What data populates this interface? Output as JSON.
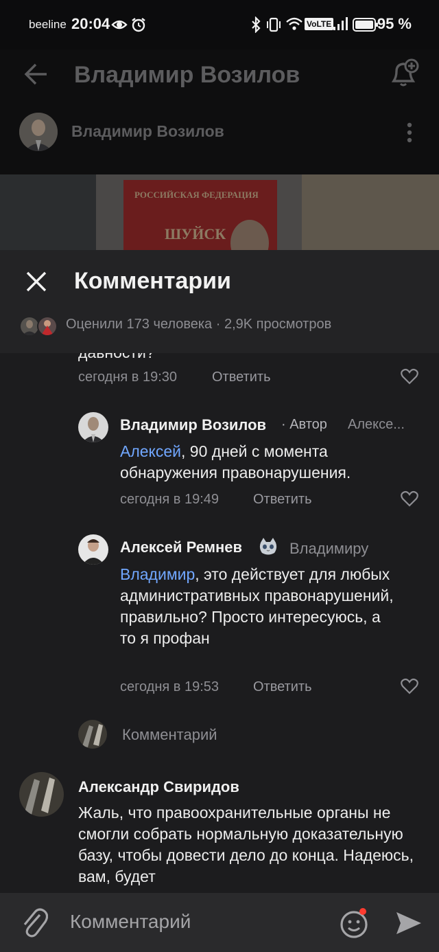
{
  "status_bar": {
    "carrier": "beeline",
    "time": "20:04",
    "volte": "VoLTE",
    "battery": "95 %"
  },
  "background_page": {
    "title": "Владимир Возилов",
    "author": "Владимир Возилов",
    "image_text_1": "РОССИЙСКАЯ ФЕДЕРАЦИЯ",
    "image_text_2": "ШУЙСК"
  },
  "sheet": {
    "title": "Комментарии",
    "stats": "Оценили 173 человека · 2,9K просмотров"
  },
  "comments": [
    {
      "partial_text": "давности?",
      "time": "сегодня в 19:30",
      "reply": "Ответить"
    },
    {
      "author": "Владимир Возилов",
      "badge": "· Автор",
      "reply_to": "Алексе...",
      "mention": "Алексей",
      "text": ", 90 дней с момента обнаружения правонарушения.",
      "time": "сегодня в 19:49",
      "reply": "Ответить"
    },
    {
      "author": "Алексей Ремнев",
      "reply_to": "Владимиру",
      "mention": "Владимир",
      "text": ", это действует для любых административных правонарушений, правильно? Просто интересуюсь, а то я профан",
      "time": "сегодня в 19:53",
      "reply": "Ответить"
    },
    {
      "author": "Александр Свиридов",
      "text": "Жаль, что правоохранительные органы не смогли собрать нормальную доказательную базу, чтобы довести дело до конца. Надеюсь, вам, будет"
    }
  ],
  "thread_reply_placeholder": "Комментарий",
  "composer": {
    "placeholder": "Комментарий"
  },
  "colors": {
    "accent_link": "#71a7ff",
    "notification_dot": "#ff3b30"
  }
}
